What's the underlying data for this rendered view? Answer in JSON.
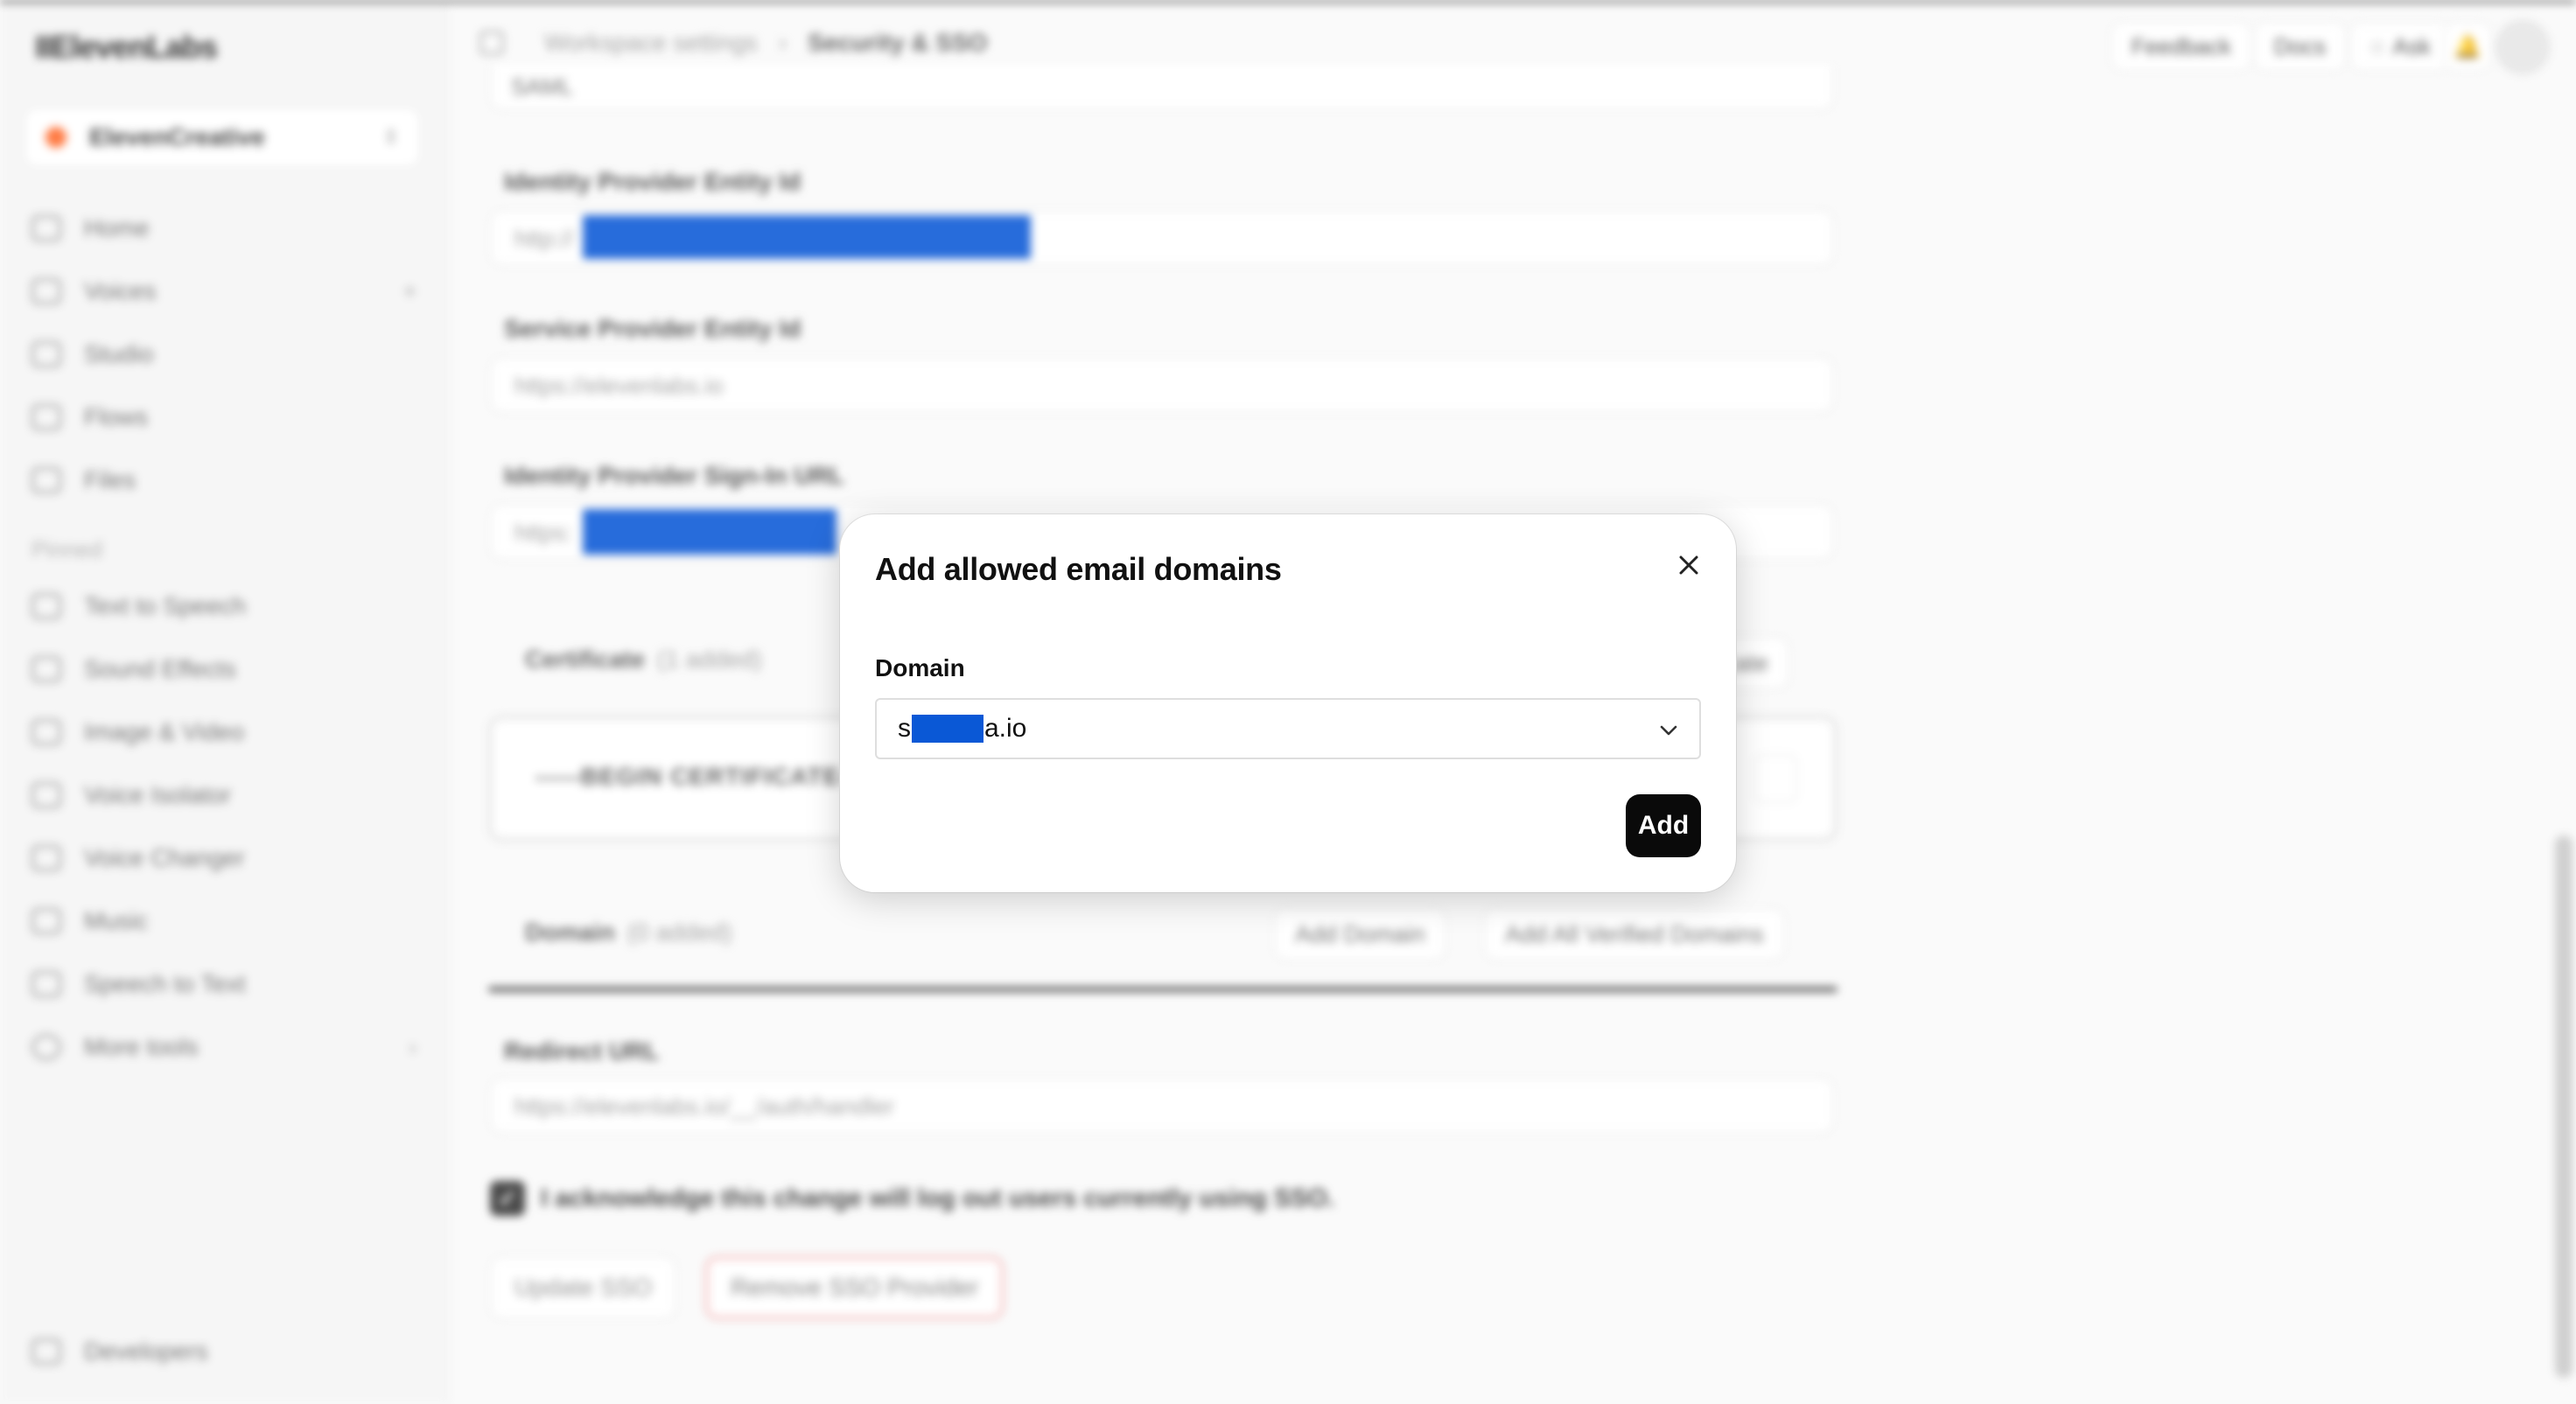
{
  "app": {
    "logo": "IIElevenLabs"
  },
  "workspace": {
    "name": "ElevenCreative"
  },
  "sidebar": {
    "items": [
      {
        "label": "Home",
        "icon": "home-icon"
      },
      {
        "label": "Voices",
        "icon": "voices-icon",
        "extra": "+"
      },
      {
        "label": "Studio",
        "icon": "studio-icon"
      },
      {
        "label": "Flows",
        "icon": "flows-icon"
      },
      {
        "label": "Files",
        "icon": "files-icon"
      }
    ],
    "pinned_label": "Pinned",
    "pinned": [
      {
        "label": "Text to Speech",
        "icon": "text-to-speech-icon"
      },
      {
        "label": "Sound Effects",
        "icon": "sound-effects-icon"
      },
      {
        "label": "Image & Video",
        "icon": "image-video-icon"
      },
      {
        "label": "Voice Isolator",
        "icon": "voice-isolator-icon"
      },
      {
        "label": "Voice Changer",
        "icon": "voice-changer-icon"
      },
      {
        "label": "Music",
        "icon": "music-icon"
      },
      {
        "label": "Speech to Text",
        "icon": "speech-to-text-icon"
      },
      {
        "label": "More tools",
        "icon": "more-tools-icon",
        "extra": "›"
      }
    ],
    "developers": "Developers"
  },
  "header": {
    "breadcrumb": [
      "Workspace settings",
      "Security & SSO"
    ],
    "feedback": "Feedback",
    "docs": "Docs",
    "ask": "Ask"
  },
  "form": {
    "protocol_value": "SAML",
    "idp_entity_label": "Identity Provider Entity Id",
    "idp_entity_value": "http://",
    "sp_entity_label": "Service Provider Entity Id",
    "sp_entity_value": "https://elevenlabs.io",
    "idp_signin_label": "Identity Provider Sign-In URL",
    "idp_signin_value": "https:",
    "certificate_label": "Certificate",
    "certificate_count": "(1 added)",
    "add_certificate": "icate",
    "certificate_text": "-----BEGIN CERTIFICATE-----",
    "domain_label": "Domain",
    "domain_count": "(0 added)",
    "add_domain": "Add Domain",
    "add_all_verified": "Add All Verified Domains",
    "redirect_label": "Redirect URL",
    "redirect_value": "https://elevenlabs.io/__/auth/handler",
    "ack_text": "I acknowledge this change will log out users currently using SSO.",
    "update_button": "Update SSO",
    "remove_button": "Remove SSO Provider"
  },
  "modal": {
    "title": "Add allowed email domains",
    "field_label": "Domain",
    "value_prefix": "s",
    "value_suffix": "a.io",
    "add_button": "Add"
  },
  "colors": {
    "redaction": "#0a58d6",
    "accent": "#0a0a0a",
    "danger_border": "#f2a2a2",
    "workspace_dot": "#ff6a2b"
  }
}
